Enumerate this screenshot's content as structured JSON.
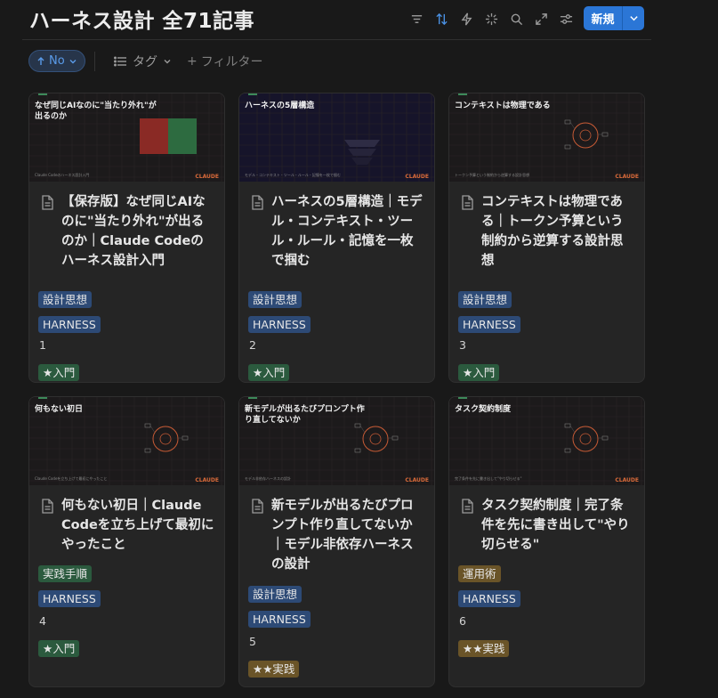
{
  "page": {
    "title": "ハーネス設計 全71記事"
  },
  "toolbar": {
    "icons": [
      "filter-icon",
      "sort-icon",
      "lightning-icon",
      "sparkle-icon",
      "search-icon",
      "expand-icon",
      "settings-sliders-icon"
    ],
    "new_label": "新規",
    "accent": "#2b76d6"
  },
  "filters": {
    "sort_label": "No",
    "tag_label": "タグ",
    "add_filter_label": "フィルター"
  },
  "colors": {
    "blue_tag": "#2d4a76",
    "green_tag": "#2b5a3e",
    "brown_tag": "#6a5428"
  },
  "cards": [
    {
      "thumb_title": "なぜ同じAIなのに\"当たり外れ\"が出るのか",
      "thumb_foot": "Claude Codeのハーネス設計入門",
      "thumb_brand": "CLAUDE",
      "title": "【保存版】なぜ同じAIなのに\"当たり外れ\"が出るのか｜Claude Codeのハーネス設計入門",
      "category": "設計思想",
      "tag": "HARNESS",
      "number": "1",
      "level": "★入門"
    },
    {
      "thumb_title": "ハーネスの5層構造",
      "thumb_foot": "モデル・コンテキスト・ツール・ルール・記憶を一枚で掴む",
      "thumb_brand": "CLAUDE",
      "title": "ハーネスの5層構造｜モデル・コンテキスト・ツール・ルール・記憶を一枚で掴む",
      "category": "設計思想",
      "tag": "HARNESS",
      "number": "2",
      "level": "★入門"
    },
    {
      "thumb_title": "コンテキストは物理である",
      "thumb_foot": "トークン予算という制約から逆算する設計思想",
      "thumb_brand": "CLAUDE",
      "title": "コンテキストは物理である｜トークン予算という制約から逆算する設計思想",
      "category": "設計思想",
      "tag": "HARNESS",
      "number": "3",
      "level": "★入門"
    },
    {
      "thumb_title": "何もない初日",
      "thumb_foot": "Claude Codeを立ち上げて最初にやったこと",
      "thumb_brand": "CLAUDE",
      "title": "何もない初日｜Claude Codeを立ち上げて最初にやったこと",
      "category": "実践手順",
      "tag": "HARNESS",
      "number": "4",
      "level": "★入門"
    },
    {
      "thumb_title": "新モデルが出るたびプロンプト作り直してないか",
      "thumb_foot": "モデル非依存ハーネスの設計",
      "thumb_brand": "CLAUDE",
      "title": "新モデルが出るたびプロンプト作り直してないか｜モデル非依存ハーネスの設計",
      "category": "設計思想",
      "tag": "HARNESS",
      "number": "5",
      "level": "★★実践"
    },
    {
      "thumb_title": "タスク契約制度",
      "thumb_foot": "完了条件を先に書き出して\"やり切らせる\"",
      "thumb_brand": "CLAUDE",
      "title": "タスク契約制度｜完了条件を先に書き出して\"やり切らせる\"",
      "category": "運用術",
      "tag": "HARNESS",
      "number": "6",
      "level": "★★実践"
    }
  ]
}
